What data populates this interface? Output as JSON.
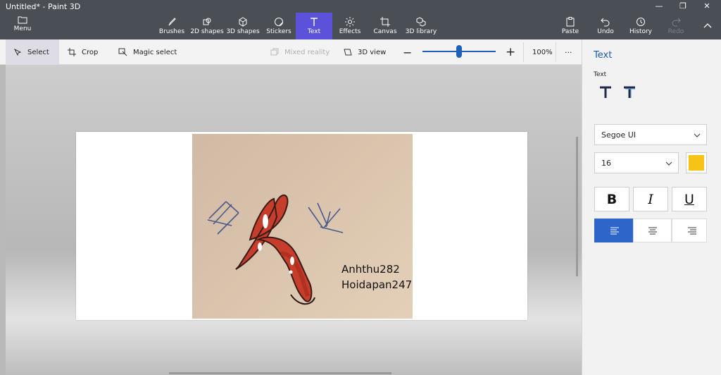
{
  "window": {
    "title": "Untitled* - Paint 3D"
  },
  "ribbon": {
    "menu": "Menu",
    "tools": [
      "Brushes",
      "2D shapes",
      "3D shapes",
      "Stickers",
      "Text",
      "Effects",
      "Canvas",
      "3D library"
    ],
    "active_tool": "Text",
    "right": [
      "Paste",
      "Undo",
      "History",
      "Redo"
    ]
  },
  "toolbar": {
    "select": "Select",
    "crop": "Crop",
    "magic_select": "Magic select",
    "mixed_reality": "Mixed reality",
    "view_3d": "3D view",
    "zoom": "100%",
    "zoom_level": 0.5,
    "more": "···"
  },
  "canvas": {
    "photo_text_1": "Anhthu282",
    "photo_text_2": "Hoidapan247"
  },
  "panel": {
    "title": "Text",
    "subtitle": "Text",
    "font": "Segoe UI",
    "size": "16",
    "color": "#f7c317",
    "bold": "B",
    "italic": "I",
    "underline": "U",
    "accent": "#2d66c8"
  }
}
